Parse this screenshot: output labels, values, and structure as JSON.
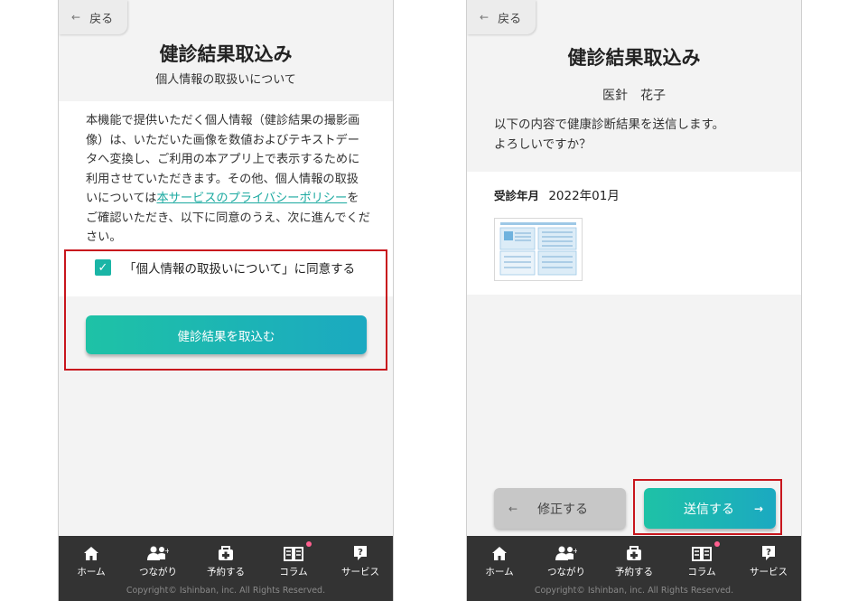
{
  "left_screen": {
    "back_label": "戻る",
    "title": "健診結果取込み",
    "subtitle": "個人情報の取扱いについて",
    "body_before_link": "本機能で提供いただく個人情報（健診結果の撮影画像）は、いただいた画像を数値およびテキストデータへ変換し、ご利用の本アプリ上で表示するために利用させていただきます。その他、個人情報の取扱いについては",
    "body_link": "本サービスのプライバシーポリシー",
    "body_after_link": "をご確認いただき、以下に同意のうえ、次に進んでください。",
    "checkbox_label": "「個人情報の取扱いについて」に同意する",
    "checkbox_checked": true,
    "import_button": "健診結果を取込む"
  },
  "right_screen": {
    "back_label": "戻る",
    "title": "健診結果取込み",
    "user_name": "医針　花子",
    "confirm_line1": "以下の内容で健康診断結果を送信します。",
    "confirm_line2": "よろしいですか？",
    "exam_label": "受診年月",
    "exam_value": "2022年01月",
    "edit_button": "修正する",
    "send_button": "送信する"
  },
  "tabbar": {
    "items": [
      {
        "label": "ホーム",
        "icon": "home-icon"
      },
      {
        "label": "つながり",
        "icon": "people-icon"
      },
      {
        "label": "予約する",
        "icon": "medical-bag-icon"
      },
      {
        "label": "コラム",
        "icon": "book-icon",
        "badge": true
      },
      {
        "label": "サービス",
        "icon": "help-icon"
      }
    ],
    "copyright": "Copyright© Ishinban, inc. All Rights Reserved."
  },
  "colors": {
    "accent_teal": "#1ab5a6",
    "highlight_red": "#c8161d",
    "tabbar_bg": "#333333",
    "badge_pink": "#ff5f8f"
  }
}
